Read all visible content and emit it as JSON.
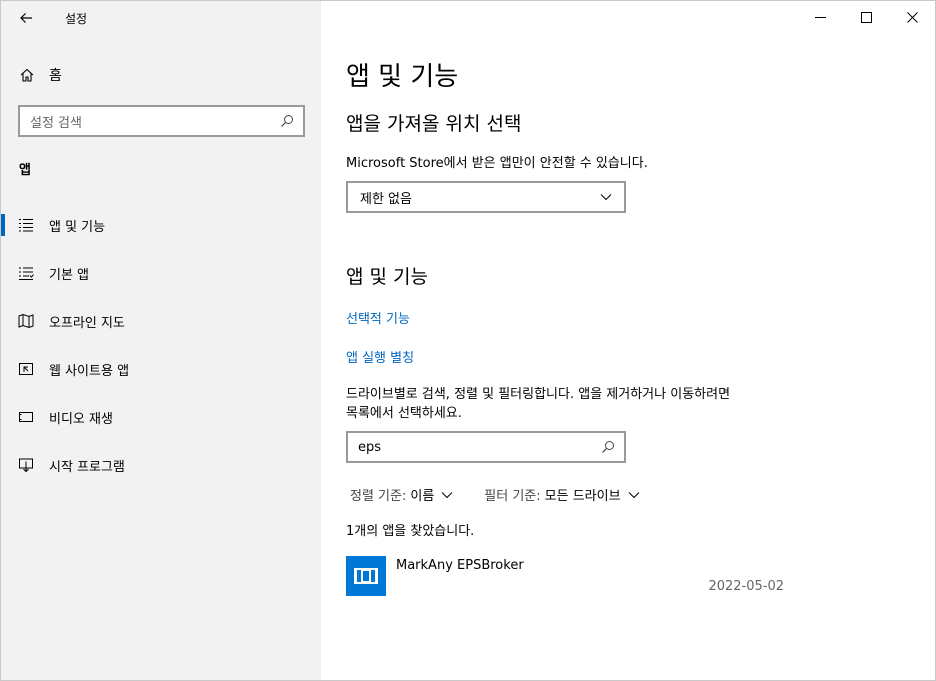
{
  "window": {
    "title": "설정",
    "controls": [
      "minimize-icon",
      "maximize-icon",
      "close-icon"
    ]
  },
  "sidebar": {
    "home_label": "홈",
    "search_placeholder": "설정 검색",
    "section_header": "앱",
    "items": [
      {
        "label": "앱 및 기능",
        "icon": "apps-list-icon",
        "active": true
      },
      {
        "label": "기본 앱",
        "icon": "default-apps-icon",
        "active": false
      },
      {
        "label": "오프라인 지도",
        "icon": "map-icon",
        "active": false
      },
      {
        "label": "웹 사이트용 앱",
        "icon": "web-app-icon",
        "active": false
      },
      {
        "label": "비디오 재생",
        "icon": "video-icon",
        "active": false
      },
      {
        "label": "시작 프로그램",
        "icon": "startup-icon",
        "active": false
      }
    ]
  },
  "main": {
    "page_title": "앱 및 기능",
    "source_section": {
      "heading": "앱을 가져올 위치 선택",
      "description": "Microsoft Store에서 받은 앱만이 안전할 수 있습니다.",
      "dropdown_value": "제한 없음"
    },
    "apps_section": {
      "heading": "앱 및 기능",
      "link_optional_features": "선택적 기능",
      "link_app_aliases": "앱 실행 별칭",
      "description_line1": "드라이브별로 검색, 정렬 및 필터링합니다. 앱을 제거하거나 이동하려면",
      "description_line2": "목록에서 선택하세요.",
      "filter_value": "eps",
      "sort_label": "정렬 기준:",
      "sort_value": "이름",
      "filter_by_label": "필터 기준:",
      "filter_by_value": "모든 드라이브",
      "result_count": "1개의 앱을 찾았습니다.",
      "apps": [
        {
          "name": "MarkAny EPSBroker",
          "date": "2022-05-02"
        }
      ]
    }
  },
  "colors": {
    "accent": "#0067c0",
    "app_tile": "#0078d7",
    "sidebar_bg": "#f2f2f2"
  }
}
